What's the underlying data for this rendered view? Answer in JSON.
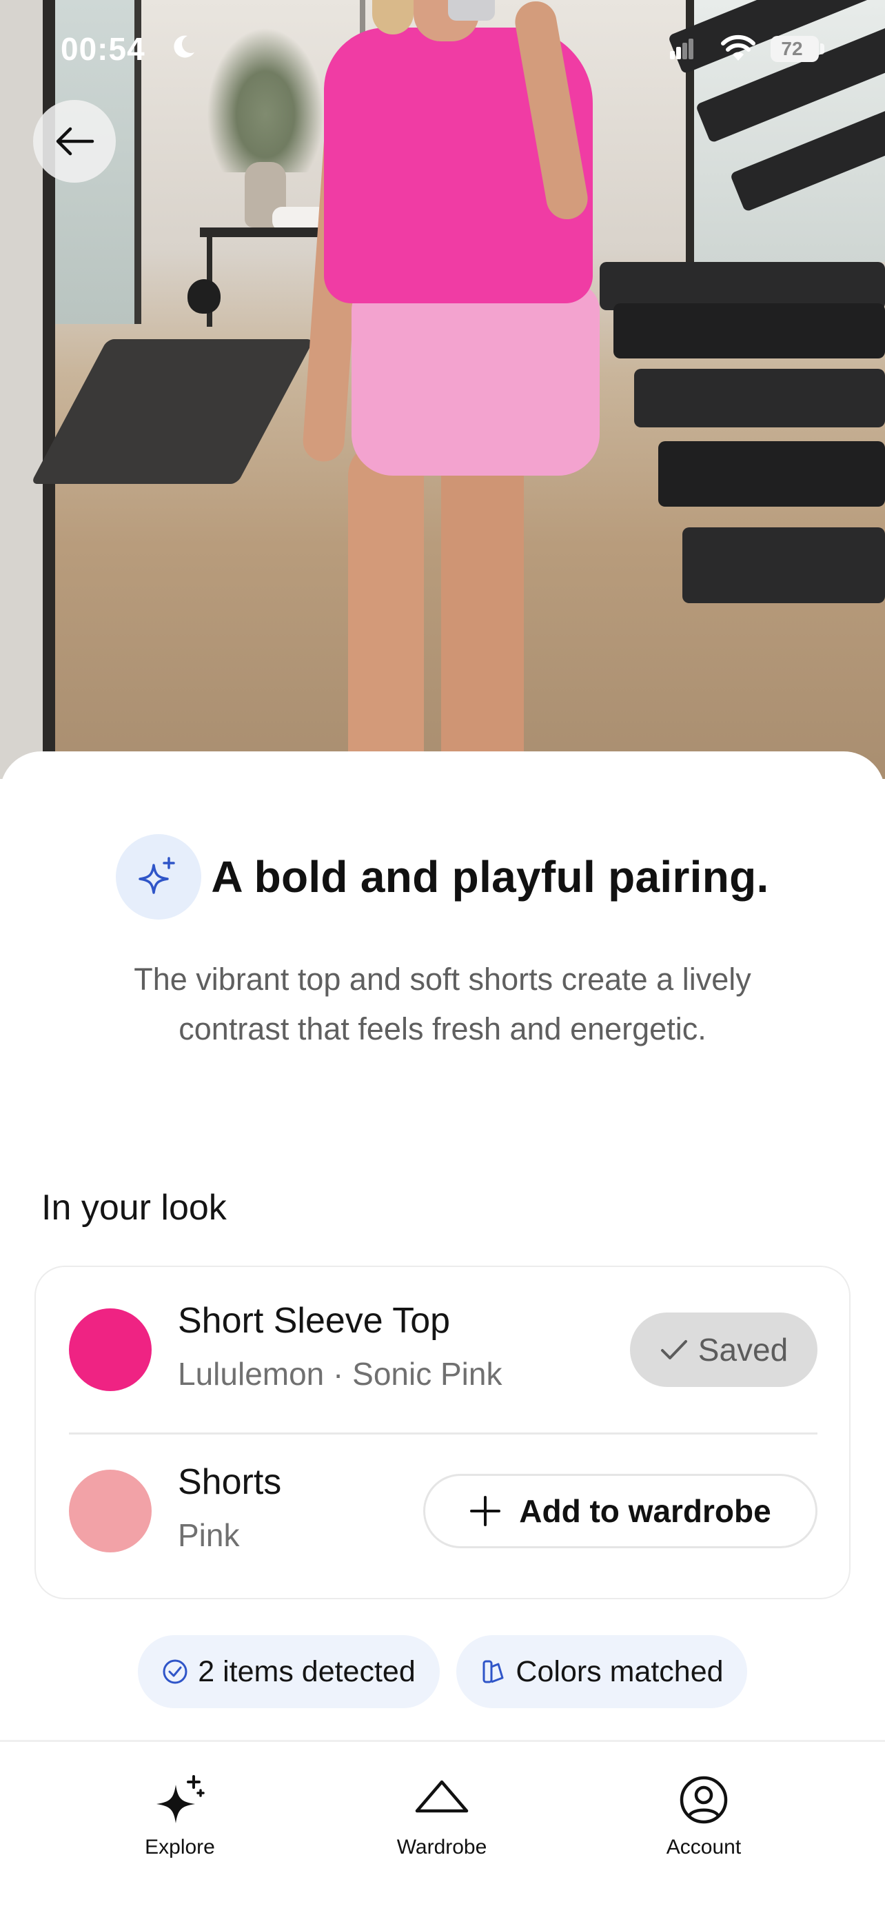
{
  "status_bar": {
    "time": "00:54",
    "battery": "72"
  },
  "icons": {
    "back": "arrow-left-icon",
    "sparkle": "sparkle-icon",
    "saved_check": "check-icon",
    "add": "plus-icon",
    "detected": "check-circle-icon",
    "colors": "swatch-icon",
    "explore": "sparkles-icon",
    "wardrobe": "hanger-icon",
    "account": "person-circle-icon"
  },
  "summary": {
    "headline": "A bold and playful pairing.",
    "description": "The vibrant top and soft shorts create a lively contrast that feels fresh and energetic."
  },
  "look": {
    "section_title": "In your look",
    "items": [
      {
        "name": "Short Sleeve Top",
        "detail": "Lululemon · Sonic Pink",
        "color": "#ef2383",
        "action_label": "Saved",
        "state": "saved"
      },
      {
        "name": "Shorts",
        "detail": "Pink",
        "color": "#f2a2a7",
        "action_label": "Add to wardrobe",
        "state": "not_saved"
      }
    ]
  },
  "chips": [
    {
      "label": "2 items detected"
    },
    {
      "label": "Colors matched"
    }
  ],
  "tab_bar": {
    "tabs": [
      {
        "label": "Explore"
      },
      {
        "label": "Wardrobe"
      },
      {
        "label": "Account"
      }
    ]
  },
  "colors": {
    "accent_blue": "#2f55c8",
    "chip_bg": "#eef3fc",
    "saved_pill_bg": "#dcdcdc"
  }
}
